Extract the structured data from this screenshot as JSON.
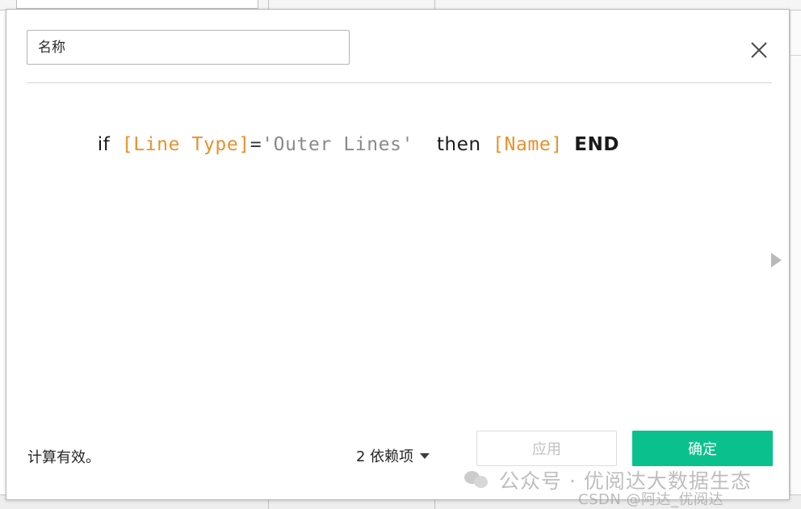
{
  "dialog": {
    "name_field": {
      "value": "",
      "placeholder": "名称"
    },
    "close_icon": "close-icon",
    "formula": {
      "tokens": [
        {
          "text": "if",
          "type": "keyword"
        },
        {
          "text": " ",
          "type": "space"
        },
        {
          "text": "[Line Type]",
          "type": "field"
        },
        {
          "text": "=",
          "type": "operator"
        },
        {
          "text": "'Outer Lines'",
          "type": "string"
        },
        {
          "text": "  ",
          "type": "space"
        },
        {
          "text": "then",
          "type": "keyword"
        },
        {
          "text": " ",
          "type": "space"
        },
        {
          "text": "[Name]",
          "type": "field"
        },
        {
          "text": " ",
          "type": "space"
        },
        {
          "text": "END",
          "type": "end"
        }
      ],
      "plain_text": "if [Line Type]='Outer Lines'  then [Name] END"
    },
    "expand_icon": "play-triangle-right-icon",
    "footer": {
      "status_text": "计算有效。",
      "dependencies_label": "2 依赖项",
      "dependencies_caret_icon": "chevron-down-icon",
      "apply_label": "应用",
      "apply_enabled": false,
      "ok_label": "确定"
    }
  },
  "watermarks": {
    "wechat_icon": "wechat-icon",
    "wechat_text": "公众号 · 优阅达大数据生态",
    "csdn_text": "CSDN @阿达_优阅达"
  },
  "colors": {
    "field_orange": "#e8912d",
    "string_gray": "#8a8a8a",
    "ok_green": "#0ac18e",
    "disabled_gray": "#c2c2c2"
  }
}
